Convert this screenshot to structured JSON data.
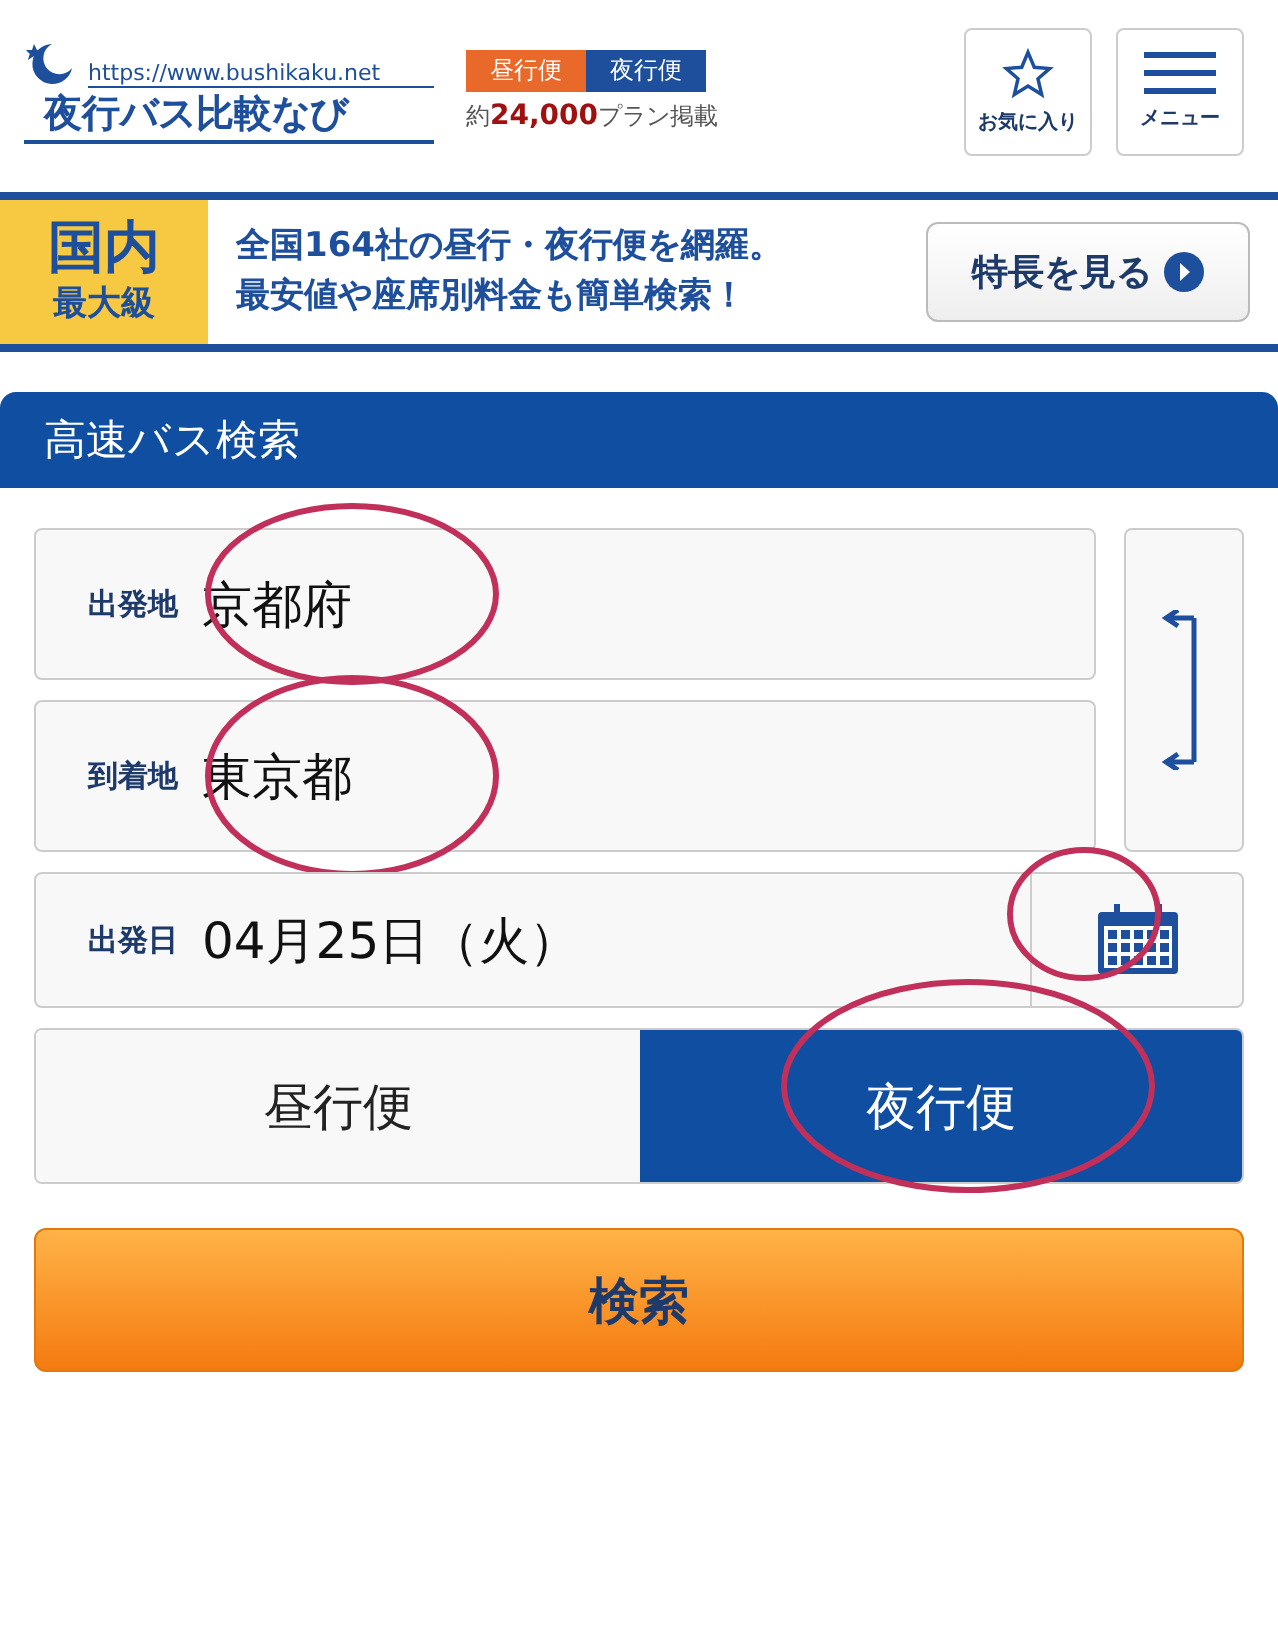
{
  "header": {
    "logo_url": "https://www.bushikaku.net",
    "logo_title": "夜行バス比較なび",
    "badges": [
      {
        "label": "昼行便",
        "color": "#e8692a"
      },
      {
        "label": "夜行便",
        "color": "#1d4f9c"
      }
    ],
    "plan_prefix": "約",
    "plan_count": "24,000",
    "plan_suffix": "プラン掲載",
    "buttons": [
      {
        "kind": "star",
        "label": "お気に入り"
      },
      {
        "kind": "menu",
        "label": "メニュー"
      }
    ]
  },
  "banner": {
    "tag_top": "国内",
    "tag_bottom": "最大級",
    "line_1": "全国164社の昼行・夜行便を網羅。",
    "line_2": "最安値や座席別料金も簡単検索！",
    "button": "特長を見る"
  },
  "search": {
    "title": "高速バス検索",
    "fields": [
      {
        "label": "出発地",
        "value": "京都府"
      },
      {
        "label": "到着地",
        "value": "東京都"
      }
    ],
    "date": {
      "label": "出発日",
      "value": "04月25日（火）"
    },
    "modes": [
      {
        "label": "昼行便",
        "selected": false
      },
      {
        "label": "夜行便",
        "selected": true
      }
    ],
    "submit": "検索"
  }
}
